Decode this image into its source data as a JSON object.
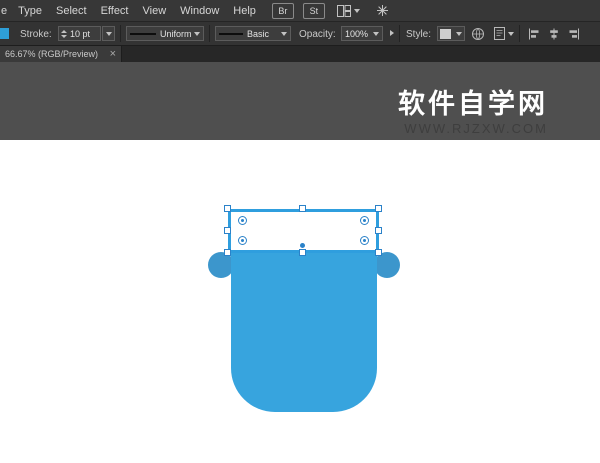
{
  "menubar": {
    "fragment": "e",
    "items": [
      "Type",
      "Select",
      "Effect",
      "View",
      "Window",
      "Help"
    ],
    "br": "Br",
    "st": "St"
  },
  "controlbar": {
    "fill_swatch_color": "#2e9fd8",
    "stroke_label": "Stroke:",
    "stroke_value": "10 pt",
    "profile_value": "Uniform",
    "brush_value": "Basic",
    "opacity_label": "Opacity:",
    "opacity_value": "100%",
    "style_label": "Style:"
  },
  "tab": {
    "title": "66.67% (RGB/Preview)",
    "close": "×"
  },
  "watermark": {
    "title": "软件自学网",
    "url": "WWW.RJZXW.COM"
  },
  "artwork": {
    "body_color": "#37a4de",
    "ear_color": "#3c96cc",
    "rect_fill": "#ffffff",
    "selection_color": "#2b82c9"
  }
}
